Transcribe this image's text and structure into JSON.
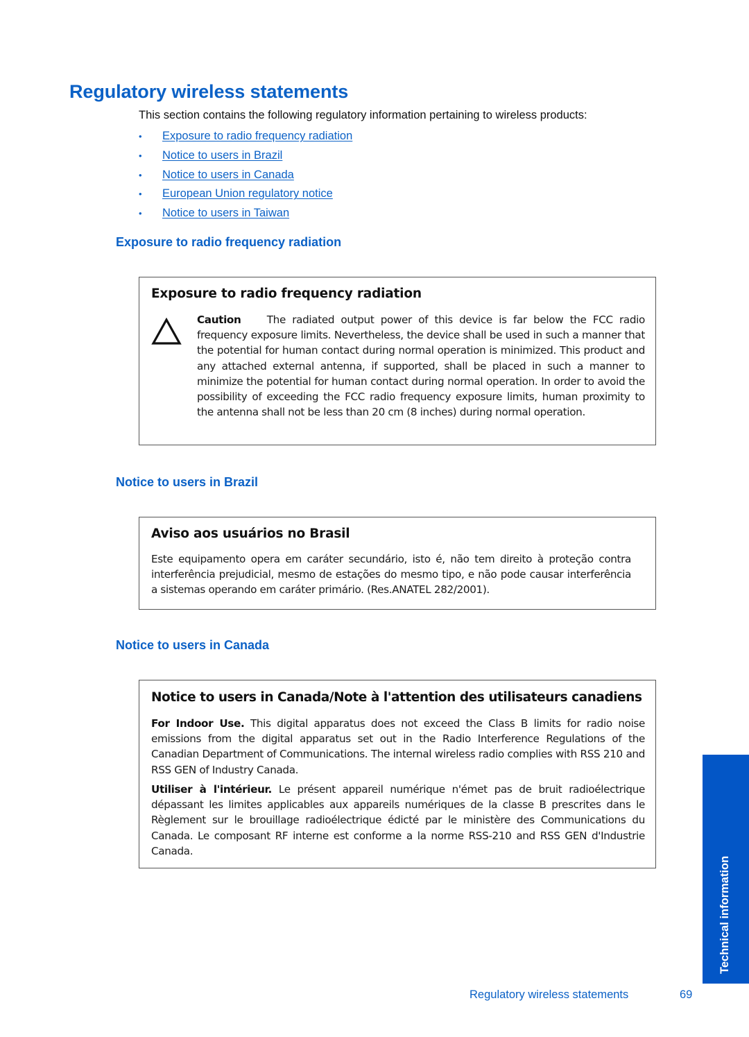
{
  "page": {
    "title": "Regulatory wireless statements",
    "intro": "This section contains the following regulatory information pertaining to wireless products:",
    "toc": [
      {
        "bullet": "•",
        "label": "Exposure to radio frequency radiation"
      },
      {
        "bullet": "•",
        "label": "Notice to users in Brazil"
      },
      {
        "bullet": "•",
        "label": "Notice to users in Canada"
      },
      {
        "bullet": "•",
        "label": "European Union regulatory notice"
      },
      {
        "bullet": "•",
        "label": "Notice to users in Taiwan"
      }
    ]
  },
  "sections": {
    "exposure": {
      "heading": "Exposure to radio frequency radiation",
      "box_title": "Exposure to radio frequency radiation",
      "icon": "caution-triangle-icon",
      "caution_label": "Caution",
      "caution_text": "The radiated output power of this device is far below the FCC radio frequency exposure limits. Nevertheless, the device shall be used in such a manner that the potential for human contact during normal operation is minimized. This product and any attached external antenna, if supported, shall be placed in such a manner to minimize the potential for human contact during normal operation. In order to avoid the possibility of exceeding the FCC radio frequency exposure limits, human proximity to the antenna shall not be less than 20 cm (8 inches) during normal operation."
    },
    "brazil": {
      "heading": "Notice to users in Brazil",
      "box_title": "Aviso aos usuários no Brasil",
      "text": "Este equipamento opera em caráter secundário, isto é, não tem direito à proteção contra interferência prejudicial, mesmo de estações do mesmo tipo, e não pode causar interferência a sistemas operando em caráter primário. (Res.ANATEL 282/2001)."
    },
    "canada": {
      "heading": "Notice to users in Canada",
      "box_title": "Notice to users in Canada/Note à l'attention des utilisateurs canadiens",
      "en_label": "For Indoor Use.",
      "en_text": "This digital apparatus does not exceed the Class B limits for radio noise emissions from the digital apparatus set out in the Radio Interference Regulations of the Canadian Department of Communications. The internal wireless radio complies with RSS 210 and RSS GEN of Industry Canada.",
      "fr_label": "Utiliser à l'intérieur.",
      "fr_text": "Le présent appareil numérique n'émet pas de bruit radioélectrique dépassant les limites applicables aux appareils numériques de la classe B prescrites dans le Règlement sur le brouillage radioélectrique édicté par le ministère des Communications du Canada. Le composant RF interne est conforme a la norme RSS-210 and RSS GEN d'Industrie Canada."
    }
  },
  "side_tab": {
    "label": "Technical information",
    "color": "#0356c6"
  },
  "footer": {
    "section_title": "Regulatory wireless statements",
    "page_number": "69"
  },
  "colors": {
    "accent": "#0b61c6",
    "text": "#1a1a1a",
    "box_border": "#555555"
  }
}
